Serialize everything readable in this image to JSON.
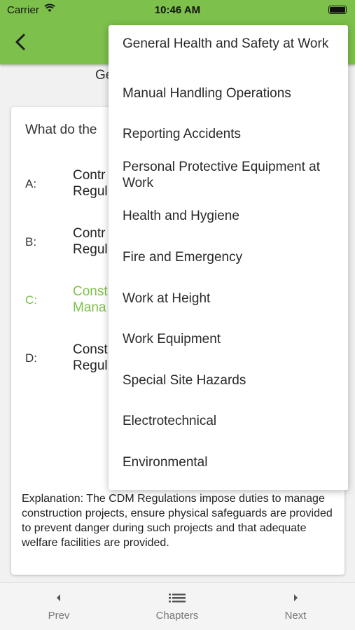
{
  "status_bar": {
    "carrier": "Carrier",
    "time": "10:46 AM"
  },
  "header": {
    "subtitle": "Ge"
  },
  "question": {
    "text": "What do the",
    "answers": [
      {
        "letter": "A:",
        "line1": "Contr",
        "line2": "Regul"
      },
      {
        "letter": "B:",
        "line1": "Contr",
        "line2": "Regul"
      },
      {
        "letter": "C:",
        "line1": "Const",
        "line2": "Mana",
        "correct": true
      },
      {
        "letter": "D:",
        "line1": "Const",
        "line2": "Regul"
      }
    ],
    "explanation": "Explanation: The CDM Regulations impose duties to manage construction projects, ensure physical safeguards are provided to prevent danger during such projects and that adequate welfare facilities are provided."
  },
  "menu": {
    "items": [
      "General Health and Safety at Work",
      "Manual Handling Operations",
      "Reporting Accidents",
      "Personal Protective Equipment at Work",
      "Health and Hygiene",
      "Fire and Emergency",
      "Work at Height",
      "Work Equipment",
      "Special Site Hazards",
      "Electrotechnical",
      "Environmental"
    ]
  },
  "bottom_nav": {
    "prev": "Prev",
    "chapters": "Chapters",
    "next": "Next"
  },
  "colors": {
    "accent": "#7dc04b",
    "correct": "#7dc04b"
  }
}
